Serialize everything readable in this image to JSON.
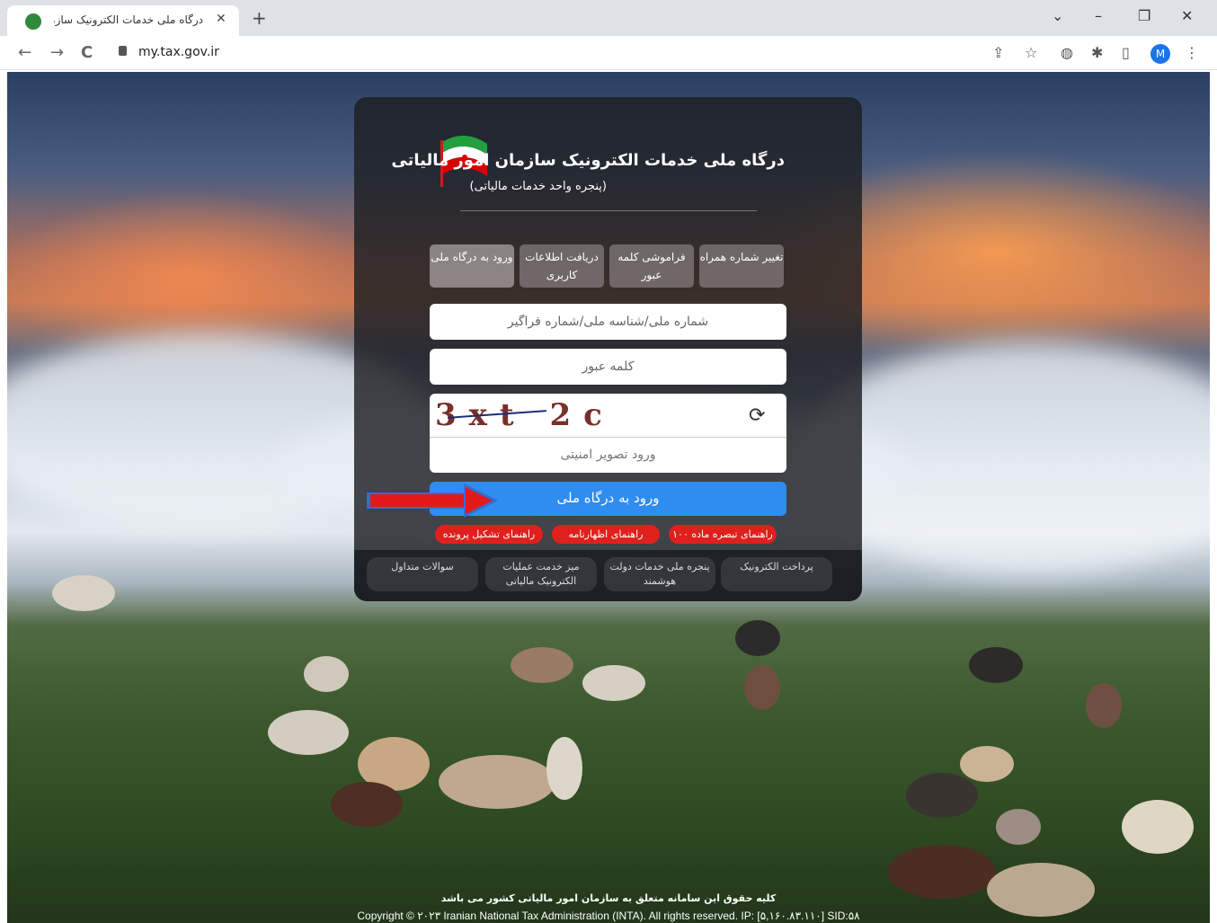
{
  "browser": {
    "tab_title": "درگاه ملی خدمات الکترونیک سازمان امور مالیاتی",
    "tab_close": "✕",
    "new_tab": "+",
    "url": "my.tax.gov.ir",
    "profile_initial": "M",
    "window_controls": {
      "dropdown": "⌄",
      "minimize": "–",
      "restore": "❐",
      "close": "✕"
    },
    "nav": {
      "back": "←",
      "forward": "→",
      "reload": "C"
    },
    "tools": {
      "share": "⇪",
      "bookmark": "☆",
      "extension": "◍",
      "puzzle": "✱",
      "sidepanel": "▯",
      "menu": "⋮"
    }
  },
  "portal": {
    "title": "درگاه ملی خدمات الکترونیک سازمان امور مالیاتی",
    "subtitle": "(پنجره واحد خدمات مالیاتی)",
    "flag_colors": {
      "green": "#239f40",
      "white": "#ffffff",
      "red": "#da0000"
    },
    "tabs": [
      {
        "label": "ورود به درگاه ملی",
        "active": true
      },
      {
        "label": "دریافت اطلاعات کاربری",
        "active": false
      },
      {
        "label": "فراموشی کلمه عبور",
        "active": false
      },
      {
        "label": "تغییر شماره همراه",
        "active": false
      }
    ],
    "username_placeholder": "شماره ملی/شناسه ملی/شماره فراگیر",
    "password_placeholder": "کلمه عبور",
    "captcha_text": "3xt 2c",
    "captcha_placeholder": "ورود تصویر امنیتی",
    "refresh_icon": "⟳",
    "submit_label": "ورود به درگاه ملی",
    "help_links": [
      {
        "label": "راهنمای تبصره ماده ۱۰۰"
      },
      {
        "label": "راهنمای اظهارنامه"
      },
      {
        "label": "راهنمای تشکیل پرونده"
      }
    ],
    "footer_links": [
      {
        "label": "پرداخت الکترونیک"
      },
      {
        "label": "پنجره ملی خدمات دولت هوشمند"
      },
      {
        "label": "میز خدمت عملیات الکترونیک مالیاتی"
      },
      {
        "label": "سوالات متداول"
      }
    ],
    "accent_colors": {
      "primary": "#2f8cf0",
      "help": "#e0201d",
      "arrow": "#e21a1a"
    }
  },
  "footer": {
    "rights_fa": "کلیه حقوق این سامانه متعلق به سازمان امور مالیاتی کشور می باشد",
    "copyright_en": "Copyright © ۲۰۲۳ Iranian National Tax Administration (INTA). All rights reserved. IP: [۵,۱۶۰.۸۳.۱۱۰] SID:۵۸"
  }
}
